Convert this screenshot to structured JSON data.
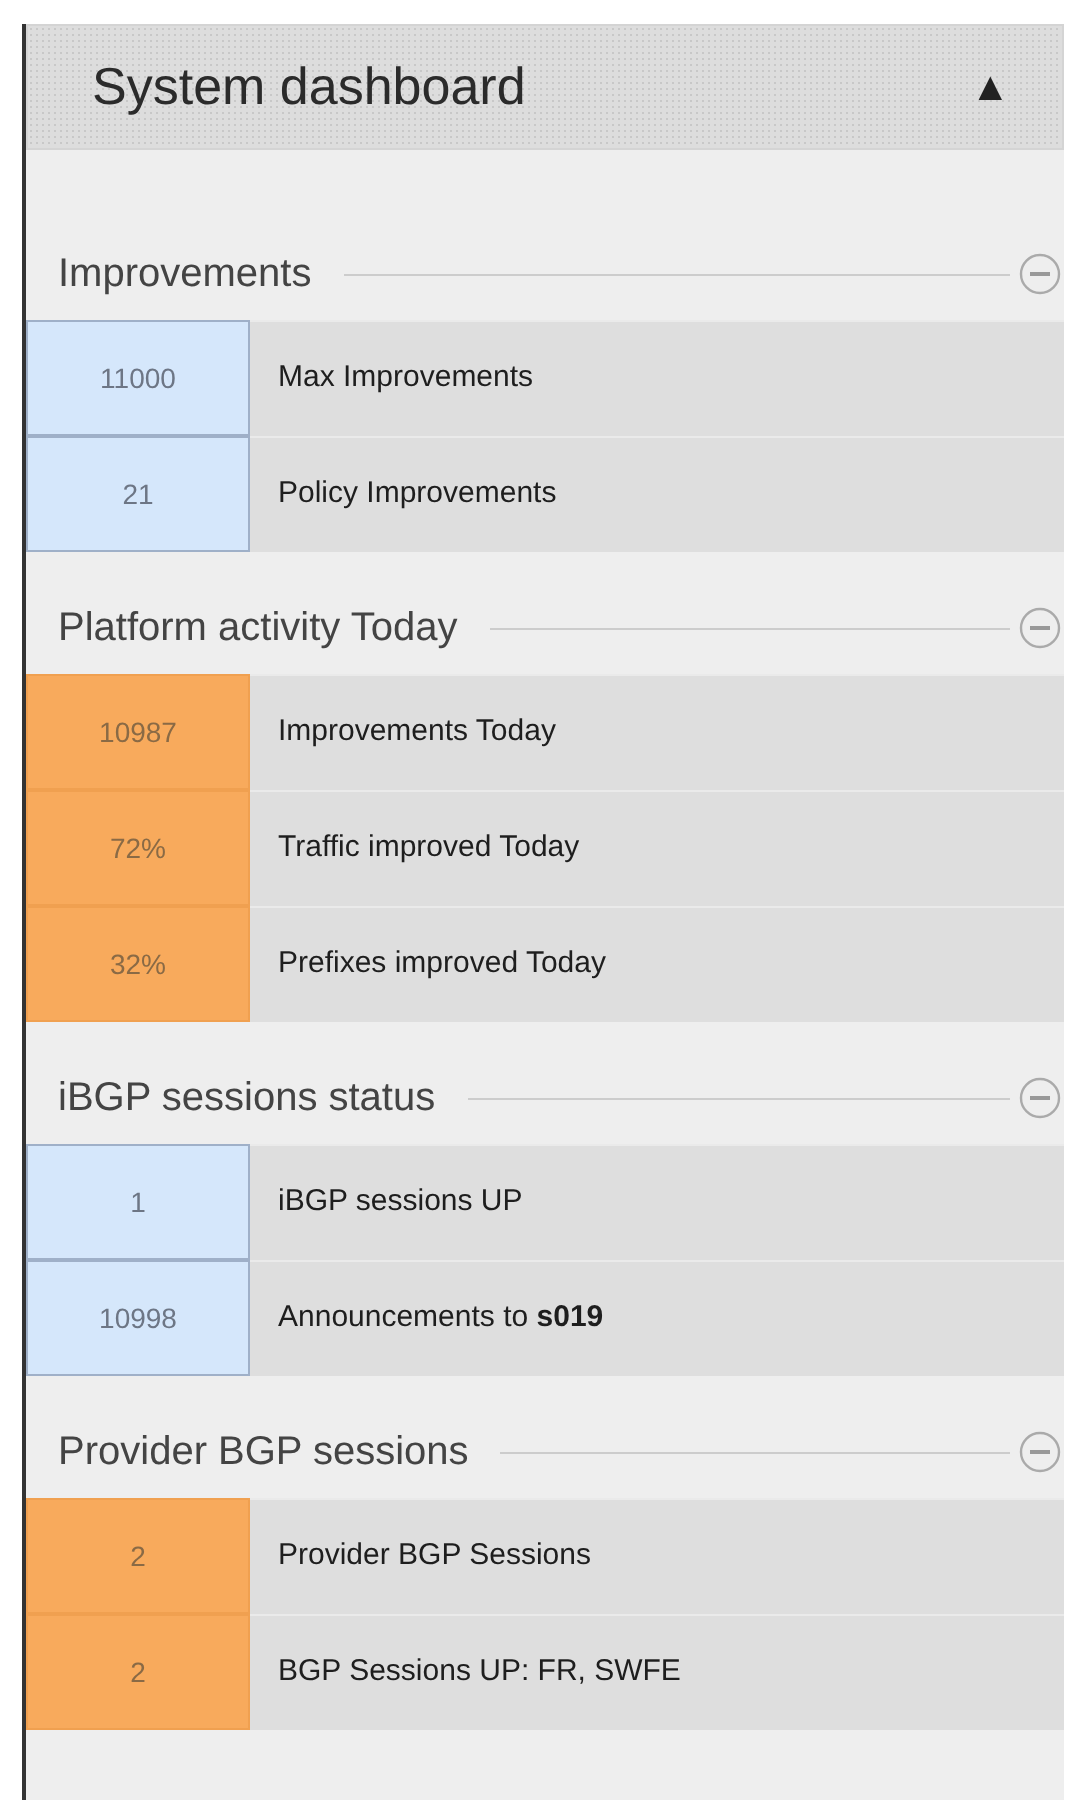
{
  "header": {
    "title": "System dashboard",
    "toggle": "▲"
  },
  "sections": [
    {
      "title": "Improvements",
      "color": "#d5e7fb",
      "rows": [
        {
          "value": "11000",
          "label": "Max Improvements"
        },
        {
          "value": "21",
          "label": "Policy Improvements"
        }
      ]
    },
    {
      "title": "Platform activity Today",
      "color": "#f8aa5c",
      "rows": [
        {
          "value": "10987",
          "label": "Improvements Today"
        },
        {
          "value": "72%",
          "label": "Traffic improved Today"
        },
        {
          "value": "32%",
          "label": "Prefixes improved Today"
        }
      ]
    },
    {
      "title": "iBGP sessions status",
      "color": "#d5e7fb",
      "rows": [
        {
          "value": "1",
          "label": "iBGP sessions UP"
        },
        {
          "value": "10998",
          "label": "Announcements to **s019**"
        }
      ]
    },
    {
      "title": "Provider BGP sessions",
      "color": "#f8aa5c",
      "rows": [
        {
          "value": "2",
          "label": "Provider BGP Sessions"
        },
        {
          "value": "2",
          "label": "BGP Sessions UP: FR, SWFE"
        }
      ]
    }
  ]
}
